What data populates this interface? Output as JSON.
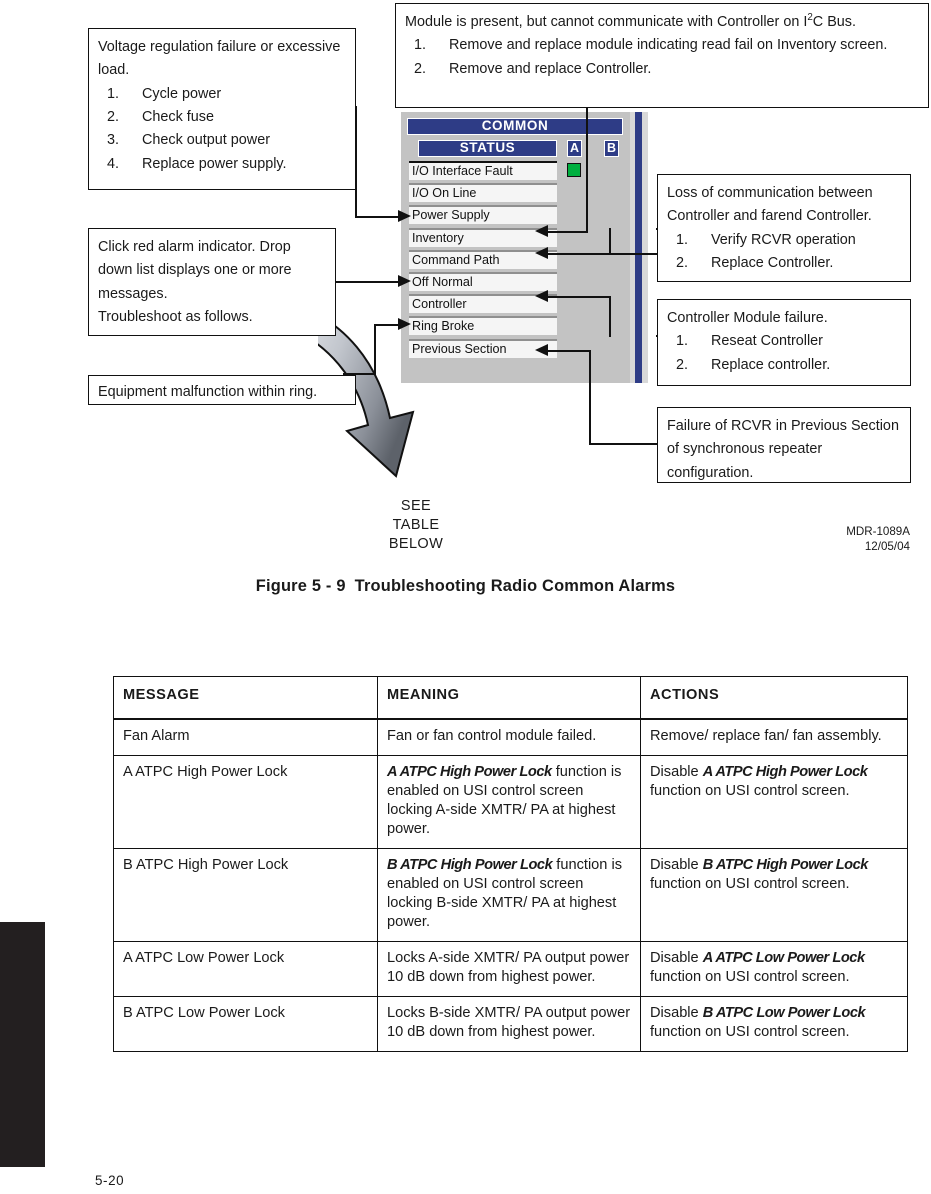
{
  "callouts": {
    "power_supply": {
      "intro": "Voltage regulation failure or excessive load.",
      "steps": [
        "Cycle power",
        "Check fuse",
        "Check output power",
        "Replace power supply."
      ]
    },
    "inventory": {
      "intro_a": "Module is present, but cannot communicate with Controller on I",
      "intro_sup": "2",
      "intro_b": "C Bus.",
      "steps": [
        "Remove and replace module indicating read fail on Inventory screen.",
        "Remove and replace Controller."
      ]
    },
    "alarm_indicator": {
      "line1": "Click red alarm indicator. Drop down list displays one or more messages.",
      "line2": "Troubleshoot as follows."
    },
    "ring_broke": {
      "text": "Equipment malfunction within ring."
    },
    "command_path": {
      "intro": "Loss of communication between Controller and farend Controller.",
      "steps": [
        "Verify RCVR operation",
        "Replace Controller."
      ]
    },
    "controller": {
      "intro": "Controller Module failure.",
      "steps": [
        "Reseat Controller",
        "Replace controller."
      ]
    },
    "previous_section": {
      "text": "Failure of RCVR in Previous Section of synchronous repeater configuration."
    }
  },
  "app_panel": {
    "common_label": "COMMON",
    "status_label": "STATUS",
    "column_a": "A",
    "column_b": "B",
    "led_color": "#00af3f",
    "accent_color": "#2e3c86",
    "rows": [
      "I/O Interface Fault",
      "I/O On Line",
      "Power Supply",
      "Inventory",
      "Command Path",
      "Off Normal",
      "Controller",
      "Ring Broke",
      "Previous Section"
    ]
  },
  "see_table_below": "SEE\nTABLE\nBELOW",
  "see_table_below_lines": [
    "SEE",
    "TABLE",
    "BELOW"
  ],
  "mdr": {
    "number": "MDR-1089A",
    "date": "12/05/04"
  },
  "figure": {
    "label": "Figure 5 - 9",
    "title": "Troubleshooting Radio Common Alarms"
  },
  "table": {
    "headers": [
      "MESSAGE",
      "MEANING",
      "ACTIONS"
    ],
    "rows": [
      {
        "message": "Fan Alarm",
        "meaning_pre": "",
        "meaning_bold": "",
        "meaning_post": "Fan or fan control module failed.",
        "action_pre": "Remove/ replace fan/ fan assembly.",
        "action_bold": "",
        "action_post": ""
      },
      {
        "message": "A ATPC High Power Lock",
        "meaning_pre": "",
        "meaning_bold": "A ATPC High Power Lock",
        "meaning_post": " function is enabled on USI control screen locking A-side XMTR/ PA at highest power.",
        "action_pre": "Disable ",
        "action_bold": "A ATPC High Power Lock",
        "action_post": " function on USI control screen."
      },
      {
        "message": "B ATPC High Power Lock",
        "meaning_pre": "",
        "meaning_bold": "B ATPC High Power Lock",
        "meaning_post": " function is enabled on USI control screen locking B-side XMTR/ PA at highest power.",
        "action_pre": "Disable ",
        "action_bold": "B ATPC High Power Lock",
        "action_post": " function on USI control screen."
      },
      {
        "message": "A ATPC Low Power Lock",
        "meaning_pre": "Locks A-side XMTR/ PA output power 10 dB down from highest power.",
        "meaning_bold": "",
        "meaning_post": "",
        "action_pre": "Disable ",
        "action_bold": "A ATPC Low Power Lock",
        "action_post": " function on USI control screen."
      },
      {
        "message": "B ATPC Low Power Lock",
        "meaning_pre": "Locks B-side XMTR/ PA output power 10 dB down from highest power.",
        "meaning_bold": "",
        "meaning_post": "",
        "action_pre": "Disable ",
        "action_bold": "B ATPC Low Power Lock",
        "action_post": " function on USI control screen."
      }
    ]
  },
  "page_number": "5-20"
}
